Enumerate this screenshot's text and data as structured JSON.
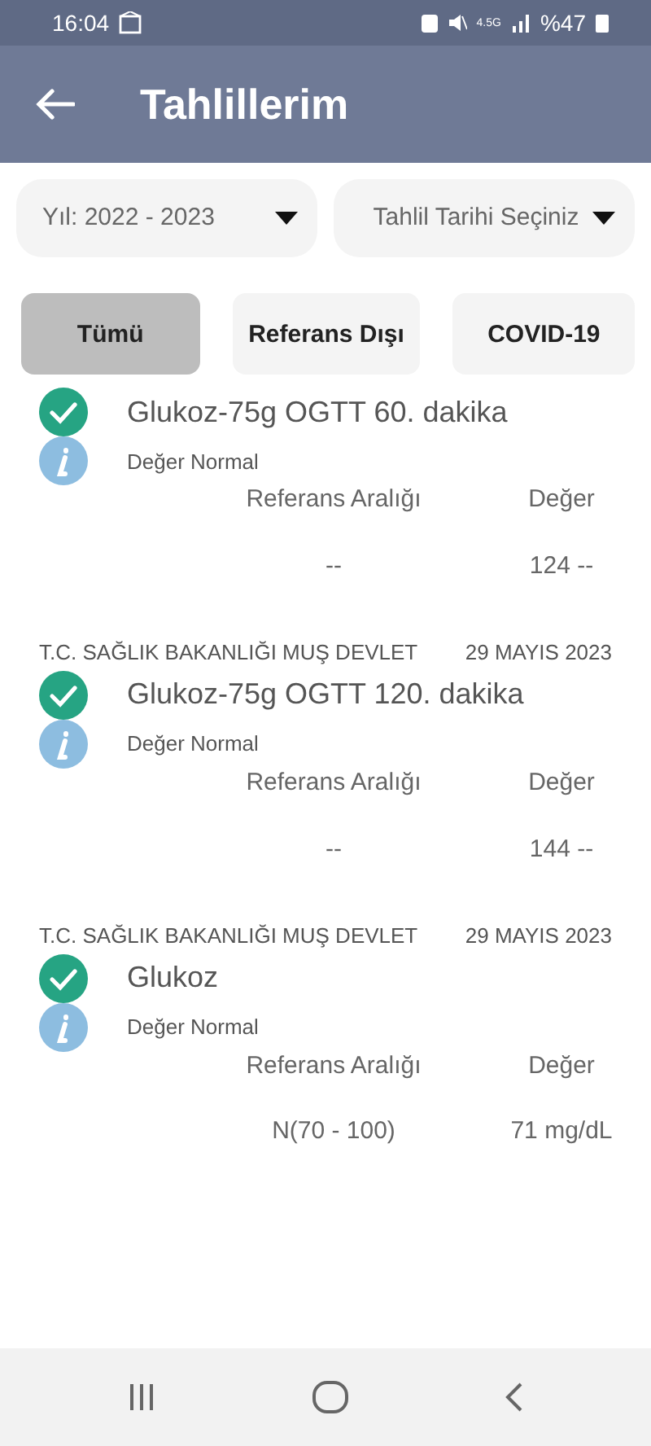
{
  "status_bar": {
    "time": "16:04",
    "network": "4.5G",
    "battery": "%47"
  },
  "app_bar": {
    "title": "Tahlillerim"
  },
  "filters": [
    {
      "label": "Yıl: 2022 - 2023"
    },
    {
      "label": "Tahlil Tarihi Seçiniz"
    }
  ],
  "tabs": [
    {
      "label": "Tümü",
      "selected": true
    },
    {
      "label": "Referans Dışı",
      "selected": false
    },
    {
      "label": "COVID-19",
      "selected": false
    }
  ],
  "results": [
    {
      "test": "Glukoz-75g OGTT 60. dakika",
      "status": "Değer Normal",
      "normal": true,
      "ref_header": "Referans Aralığı",
      "value_header": "Değer",
      "ref": "--",
      "value": "124 --"
    },
    {
      "hospital": "T.C. SAĞLIK BAKANLIĞI MUŞ DEVLET",
      "date": "29 MAYIS 2023",
      "test": "Glukoz-75g OGTT 120. dakika",
      "status": "Değer Normal",
      "normal": true,
      "ref_header": "Referans Aralığı",
      "value_header": "Değer",
      "ref": "--",
      "value": "144 --"
    },
    {
      "hospital": "T.C. SAĞLIK BAKANLIĞI MUŞ DEVLET",
      "date": "29 MAYIS 2023",
      "test": "Glukoz",
      "status": "Değer Normal",
      "normal": true,
      "ref_header": "Referans Aralığı",
      "value_header": "Değer",
      "ref": "N(70 - 100)",
      "value": "71 mg/dL"
    }
  ]
}
